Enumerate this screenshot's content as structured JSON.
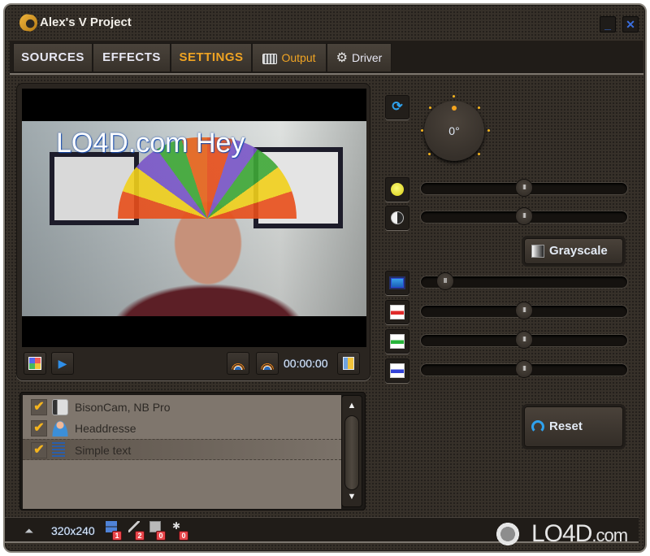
{
  "window": {
    "title": "Alex's V Project",
    "minimize_label": "_",
    "close_label": "✕"
  },
  "tabs": [
    {
      "label": "SOURCES",
      "active": false
    },
    {
      "label": "EFFECTS",
      "active": false
    },
    {
      "label": "SETTINGS",
      "active": true
    },
    {
      "label": "Output",
      "icon": "mixer-icon",
      "active": false
    },
    {
      "label": "Driver",
      "icon": "gear-icon",
      "active": false
    }
  ],
  "preview": {
    "overlay_text": "LO4D.com Hey",
    "timecode": "00:00:00",
    "play_glyph": "▶"
  },
  "layers": [
    {
      "label": "BisonCam, NB Pro",
      "checked": true,
      "icon": "webcam-icon",
      "selected": false
    },
    {
      "label": "Headdresse",
      "checked": true,
      "icon": "person-icon",
      "selected": false
    },
    {
      "label": "Simple text",
      "checked": true,
      "icon": "text-lines-icon",
      "selected": true
    }
  ],
  "check_glyph": "✔",
  "scroll": {
    "up": "▲",
    "down": "▼"
  },
  "settings": {
    "rotation_label": "0°",
    "rotation_degrees": 0,
    "sliders": [
      {
        "name": "brightness",
        "value": 0.5
      },
      {
        "name": "contrast",
        "value": 0.5
      },
      {
        "name": "zoom",
        "value": 0.08
      },
      {
        "name": "red",
        "value": 0.5
      },
      {
        "name": "green",
        "value": 0.5
      },
      {
        "name": "blue",
        "value": 0.5
      }
    ],
    "thumb_glyph": "III",
    "grayscale_label": "Grayscale",
    "reset_label": "Reset"
  },
  "statusbar": {
    "resolution": "320x240",
    "counts": [
      {
        "name": "sources",
        "value": "1"
      },
      {
        "name": "effects",
        "value": "2"
      },
      {
        "name": "images",
        "value": "0"
      },
      {
        "name": "other",
        "value": "0"
      }
    ]
  },
  "watermark": {
    "brand": "LO4D",
    "suffix": ".com"
  }
}
